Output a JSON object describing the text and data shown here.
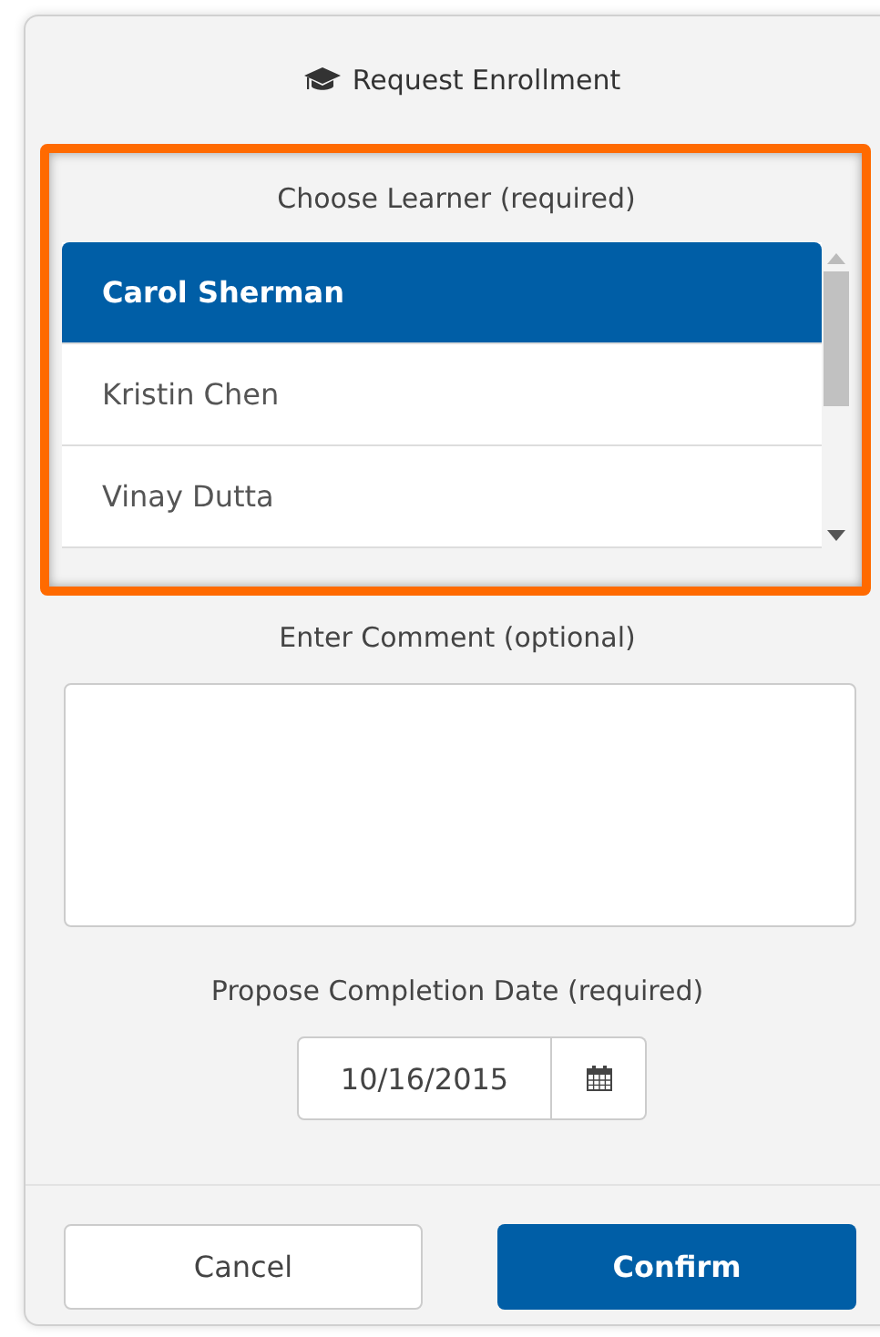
{
  "dialog": {
    "title": "Request Enrollment"
  },
  "learner": {
    "label": "Choose Learner (required)",
    "options": [
      {
        "name": "Carol Sherman",
        "selected": true
      },
      {
        "name": "Kristin Chen",
        "selected": false
      },
      {
        "name": "Vinay Dutta",
        "selected": false
      }
    ]
  },
  "comment": {
    "label": "Enter Comment (optional)"
  },
  "completion_date": {
    "label": "Propose Completion Date (required)",
    "value": "10/16/2015"
  },
  "buttons": [
    {
      "label": "Cancel",
      "kind": "secondary"
    },
    {
      "label": "Confirm",
      "kind": "primary"
    }
  ]
}
